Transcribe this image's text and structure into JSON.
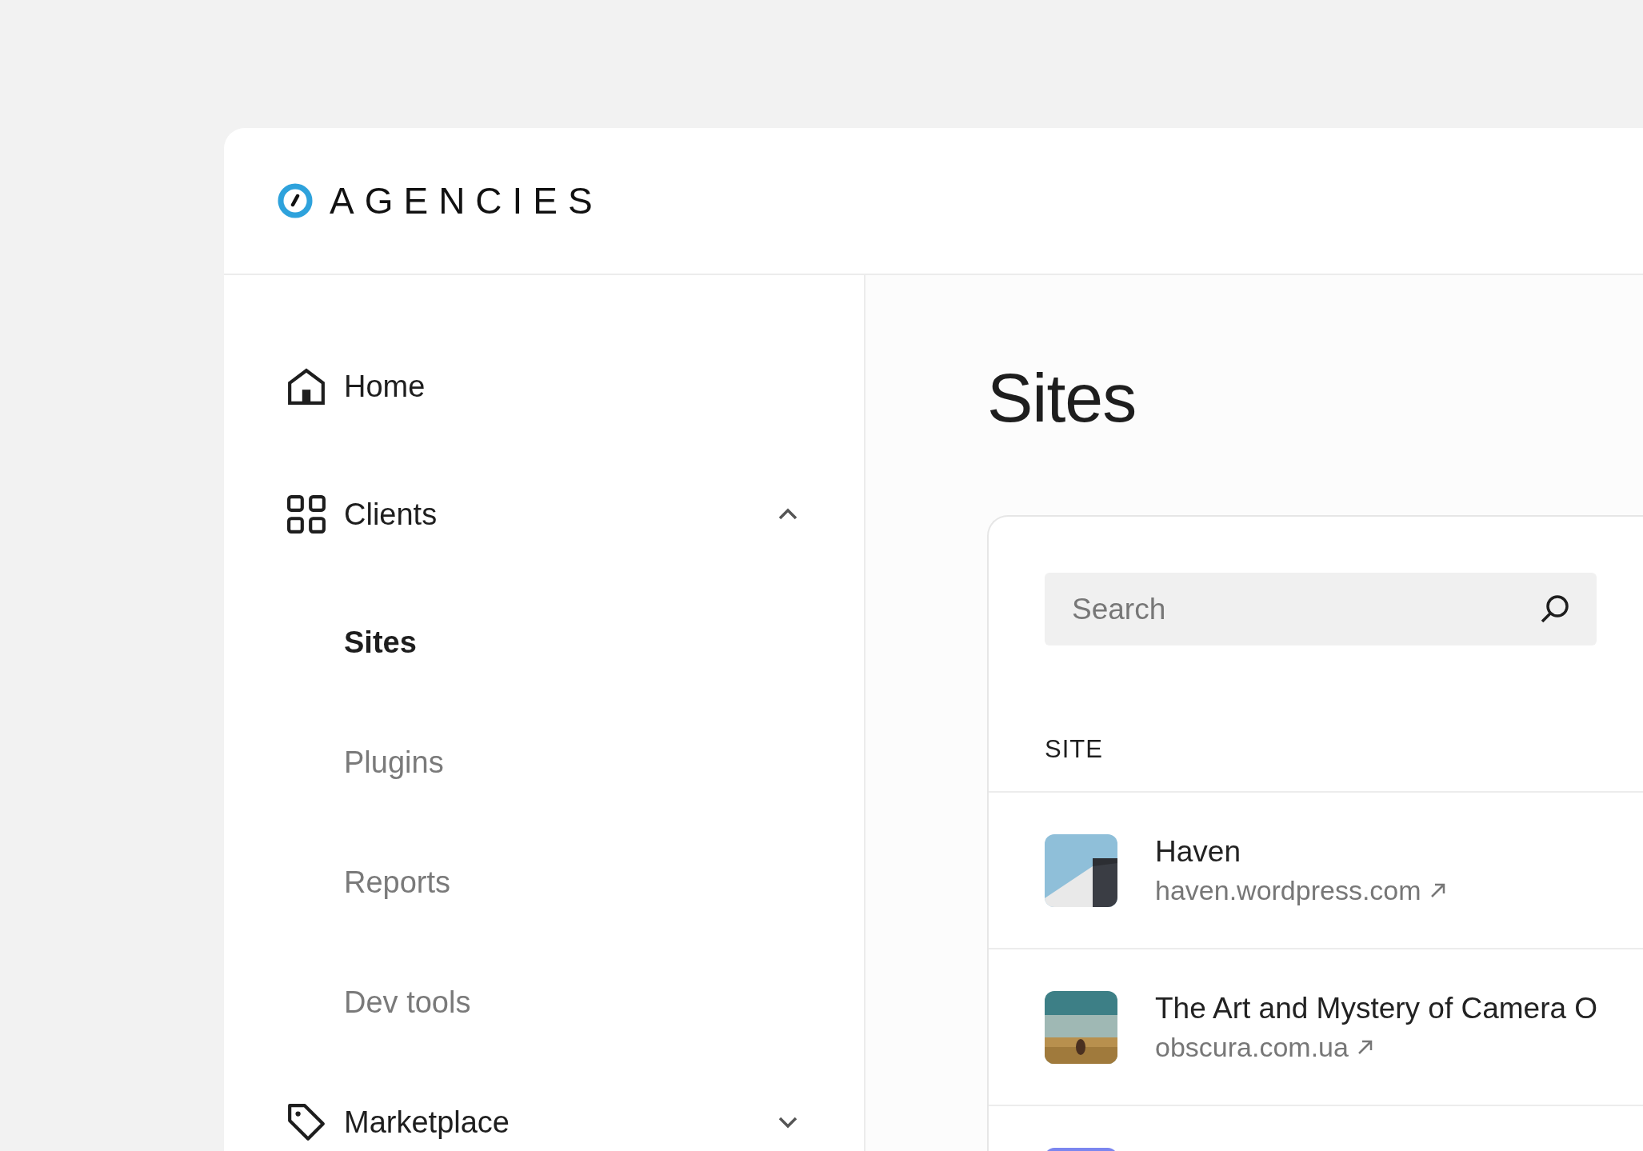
{
  "brand": {
    "name": "AGENCIES"
  },
  "sidebar": {
    "items": [
      {
        "label": "Home"
      },
      {
        "label": "Clients",
        "expanded": true,
        "children": [
          {
            "label": "Sites",
            "selected": true
          },
          {
            "label": "Plugins",
            "selected": false
          },
          {
            "label": "Reports",
            "selected": false
          },
          {
            "label": "Dev tools",
            "selected": false
          }
        ]
      },
      {
        "label": "Marketplace",
        "expanded": false
      }
    ]
  },
  "page": {
    "title": "Sites"
  },
  "search": {
    "placeholder": "Search"
  },
  "table": {
    "columns": [
      "SITE"
    ],
    "rows": [
      {
        "thumbnail": {
          "kind": "picture"
        },
        "title": "Haven",
        "url": "haven.wordpress.com"
      },
      {
        "thumbnail": {
          "kind": "picture"
        },
        "title": "The Art and Mystery of Camera O",
        "url": "obscura.com.ua"
      },
      {
        "thumbnail": {
          "kind": "picture"
        }
      }
    ]
  }
}
